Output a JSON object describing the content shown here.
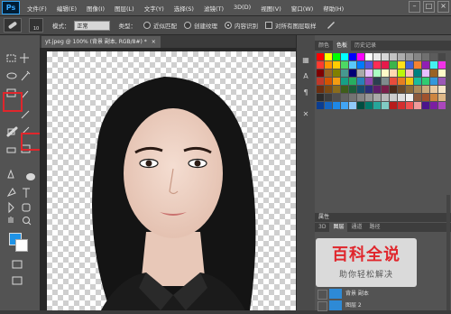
{
  "app": {
    "logo": "Ps"
  },
  "menu": [
    "文件(F)",
    "编辑(E)",
    "图像(I)",
    "图层(L)",
    "文字(Y)",
    "选择(S)",
    "滤镜(T)",
    "3D(D)",
    "视图(V)",
    "窗口(W)",
    "帮助(H)"
  ],
  "window_controls": {
    "minimize": "–",
    "maximize": "□",
    "close": "×"
  },
  "options": {
    "brush_size": "10",
    "mode_label": "模式：",
    "mode_value": "正常",
    "type_label": "类型：",
    "radio_1": "近似匹配",
    "radio_2": "创建纹理",
    "radio_3": "内容识别",
    "sample_all": "对所有图层取样"
  },
  "document": {
    "tab_title": "yt.jpeg @ 100% (背景 副本, RGB/8#) *",
    "close": "×"
  },
  "right_panel": {
    "tabs": [
      "颜色",
      "色板",
      "历史记录"
    ],
    "active_tab": "色板",
    "properties_label": "属性",
    "layer_tabs": [
      "3D",
      "图层",
      "通道",
      "路径"
    ],
    "active_layer_tab": "图层",
    "layers": [
      {
        "name": "背景 副本"
      },
      {
        "name": "图层 2"
      }
    ]
  },
  "colors": {
    "foreground": "#1f93e6",
    "background": "#ffffff",
    "highlight": "#e0262c",
    "swatches": [
      "#ff0000",
      "#ffff00",
      "#00ff00",
      "#00ffff",
      "#0000ff",
      "#ff00ff",
      "#ffffff",
      "#ebebeb",
      "#d6d6d6",
      "#c2c2c2",
      "#adadad",
      "#999999",
      "#858585",
      "#707070",
      "#5c5c5c",
      "#474747",
      "#ff3b30",
      "#ff9500",
      "#ffcc00",
      "#4cd964",
      "#5ac8fa",
      "#007aff",
      "#5856d6",
      "#ff2d55",
      "#e6194b",
      "#3cb44b",
      "#ffe119",
      "#4363d8",
      "#f58231",
      "#911eb4",
      "#46f0f0",
      "#f032e6",
      "#800000",
      "#9a6324",
      "#808000",
      "#469990",
      "#000075",
      "#a9a9a9",
      "#e6beff",
      "#aaffc3",
      "#fffac8",
      "#ffd8b1",
      "#bcf60c",
      "#fabebe",
      "#008080",
      "#e6beff",
      "#9a6324",
      "#fffac8",
      "#c0392b",
      "#d35400",
      "#f39c12",
      "#16a085",
      "#27ae60",
      "#2980b9",
      "#8e44ad",
      "#2c3e50",
      "#7f8c8d",
      "#e74c3c",
      "#e67e22",
      "#f1c40f",
      "#1abc9c",
      "#2ecc71",
      "#3498db",
      "#9b59b6",
      "#6b2d0f",
      "#7b4a12",
      "#8a6c1c",
      "#3f5d1a",
      "#1b5e3a",
      "#164c6b",
      "#2a2f7a",
      "#5e1e6b",
      "#7a1f4a",
      "#4a2a1a",
      "#6a4a2a",
      "#8a6a3a",
      "#aa8a5a",
      "#caaa7a",
      "#eacaa0",
      "#f5e6c8",
      "#2b2b2b",
      "#3d3d3d",
      "#4f4f4f",
      "#616161",
      "#737373",
      "#858585",
      "#979797",
      "#a9a9a9",
      "#bbbbbb",
      "#cdcdcd",
      "#dfdfdf",
      "#f1f1f1",
      "#8c5a3c",
      "#a0522d",
      "#cd853f",
      "#deb887",
      "#0b3d91",
      "#1565c0",
      "#1e88e5",
      "#42a5f5",
      "#90caf9",
      "#004d40",
      "#00796b",
      "#26a69a",
      "#80cbc4",
      "#b71c1c",
      "#d32f2f",
      "#ef5350",
      "#ef9a9a",
      "#4a148c",
      "#7b1fa2",
      "#ab47bc"
    ]
  },
  "watermark": {
    "title": "百科全说",
    "subtitle": "助你轻松解决"
  }
}
